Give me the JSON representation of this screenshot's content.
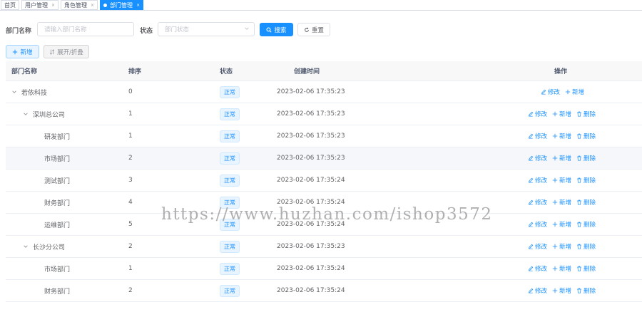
{
  "tags": [
    {
      "label": "首页",
      "closable": false,
      "active": false
    },
    {
      "label": "用户管理",
      "closable": true,
      "active": false
    },
    {
      "label": "角色管理",
      "closable": true,
      "active": false
    },
    {
      "label": "部门管理",
      "closable": true,
      "active": true
    }
  ],
  "search": {
    "dept_name_label": "部门名称",
    "dept_name_placeholder": "请输入部门名称",
    "status_label": "状态",
    "status_placeholder": "部门状态",
    "search_button": "搜索",
    "reset_button": "重置"
  },
  "toolbar": {
    "add_button": "新增",
    "toggle_button": "展开/折叠"
  },
  "table": {
    "columns": [
      "部门名称",
      "排序",
      "状态",
      "创建时间",
      "操作"
    ],
    "rows": [
      {
        "name": "若依科技",
        "level": 0,
        "expandable": true,
        "sort": "0",
        "status": "正常",
        "time": "2023-02-06 17:35:23",
        "ops": [
          "修改",
          "新增"
        ]
      },
      {
        "name": "深圳总公司",
        "level": 1,
        "expandable": true,
        "sort": "1",
        "status": "正常",
        "time": "2023-02-06 17:35:23",
        "ops": [
          "修改",
          "新增",
          "删除"
        ]
      },
      {
        "name": "研发部门",
        "level": 2,
        "expandable": false,
        "sort": "1",
        "status": "正常",
        "time": "2023-02-06 17:35:23",
        "ops": [
          "修改",
          "新增",
          "删除"
        ]
      },
      {
        "name": "市场部门",
        "level": 2,
        "expandable": false,
        "sort": "2",
        "status": "正常",
        "time": "2023-02-06 17:35:23",
        "ops": [
          "修改",
          "新增",
          "删除"
        ]
      },
      {
        "name": "测试部门",
        "level": 2,
        "expandable": false,
        "sort": "3",
        "status": "正常",
        "time": "2023-02-06 17:35:24",
        "ops": [
          "修改",
          "新增",
          "删除"
        ]
      },
      {
        "name": "财务部门",
        "level": 2,
        "expandable": false,
        "sort": "4",
        "status": "正常",
        "time": "2023-02-06 17:35:24",
        "ops": [
          "修改",
          "新增",
          "删除"
        ]
      },
      {
        "name": "运维部门",
        "level": 2,
        "expandable": false,
        "sort": "5",
        "status": "正常",
        "time": "2023-02-06 17:35:24",
        "ops": [
          "修改",
          "新增",
          "删除"
        ]
      },
      {
        "name": "长沙分公司",
        "level": 1,
        "expandable": true,
        "sort": "2",
        "status": "正常",
        "time": "2023-02-06 17:35:23",
        "ops": [
          "修改",
          "新增",
          "删除"
        ]
      },
      {
        "name": "市场部门",
        "level": 2,
        "expandable": false,
        "sort": "1",
        "status": "正常",
        "time": "2023-02-06 17:35:24",
        "ops": [
          "修改",
          "新增",
          "删除"
        ]
      },
      {
        "name": "财务部门",
        "level": 2,
        "expandable": false,
        "sort": "2",
        "status": "正常",
        "time": "2023-02-06 17:35:24",
        "ops": [
          "修改",
          "新增",
          "删除"
        ]
      }
    ]
  },
  "watermark": "https://www.huzhan.com/ishop3572",
  "colors": {
    "primary": "#1890ff",
    "header_bg": "#f8f8f9",
    "border": "#ebeef5"
  }
}
